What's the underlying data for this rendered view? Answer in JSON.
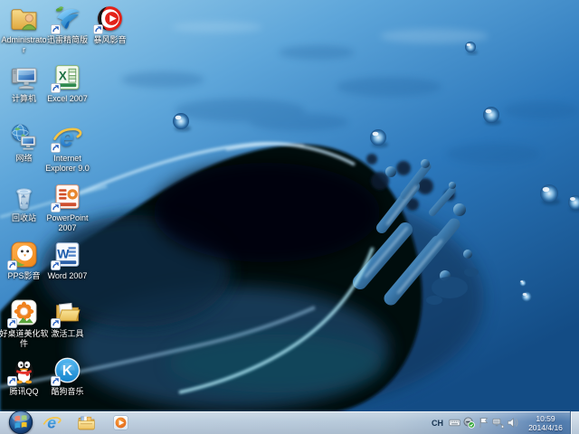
{
  "desktop": {
    "items": [
      {
        "label": "Administrato\nr",
        "icon": "user-folder-icon",
        "col": 0,
        "row": 0,
        "shortcut": false
      },
      {
        "label": "计算机",
        "icon": "computer-icon",
        "col": 0,
        "row": 1,
        "shortcut": false
      },
      {
        "label": "网络",
        "icon": "network-icon",
        "col": 0,
        "row": 2,
        "shortcut": false
      },
      {
        "label": "回收站",
        "icon": "recycle-bin-icon",
        "col": 0,
        "row": 3,
        "shortcut": false
      },
      {
        "label": "PPS影音",
        "icon": "pps-icon",
        "col": 0,
        "row": 4,
        "shortcut": true
      },
      {
        "label": "好桌道美化软\n件",
        "icon": "haozhuodao-flower-icon",
        "col": 0,
        "row": 5,
        "shortcut": true
      },
      {
        "label": "腾讯QQ",
        "icon": "qq-penguin-icon",
        "col": 0,
        "row": 6,
        "shortcut": true
      },
      {
        "label": "迅雷精简版",
        "icon": "thunder-bird-icon",
        "col": 1,
        "row": 0,
        "shortcut": true
      },
      {
        "label": "Excel 2007",
        "icon": "excel-icon",
        "col": 1,
        "row": 1,
        "shortcut": true
      },
      {
        "label": "Internet\nExplorer 9.0",
        "icon": "ie-icon",
        "col": 1,
        "row": 2,
        "shortcut": true
      },
      {
        "label": "PowerPoint\n2007",
        "icon": "powerpoint-icon",
        "col": 1,
        "row": 3,
        "shortcut": true
      },
      {
        "label": "Word 2007",
        "icon": "word-icon",
        "col": 1,
        "row": 4,
        "shortcut": true
      },
      {
        "label": "激活工具",
        "icon": "open-folder-icon",
        "col": 1,
        "row": 5,
        "shortcut": true
      },
      {
        "label": "酷狗音乐",
        "icon": "kugou-icon",
        "col": 1,
        "row": 6,
        "shortcut": true
      },
      {
        "label": "暴风影音",
        "icon": "baofeng-icon",
        "col": 2,
        "row": 0,
        "shortcut": true
      }
    ]
  },
  "taskbar": {
    "start": {
      "icon": "windows-start-orb-icon"
    },
    "pinned": [
      {
        "icon": "ie-taskbar-icon"
      },
      {
        "icon": "explorer-folder-taskbar-icon"
      },
      {
        "icon": "wmp-taskbar-icon"
      }
    ],
    "tray": {
      "language": "CH",
      "icons": [
        "keyboard-icon",
        "security-check-icon",
        "action-center-flag-icon",
        "network-tray-icon",
        "volume-icon"
      ],
      "clock": {
        "time": "10:59",
        "date": "2014/4/16"
      }
    }
  },
  "colors": {
    "taskbar_base": "#b6c9da",
    "taskbar_right_tint": "#4d79ac",
    "wallpaper_light": "#9ccfeb",
    "wallpaper_deep": "#134c85",
    "label_text": "#ffffff"
  }
}
